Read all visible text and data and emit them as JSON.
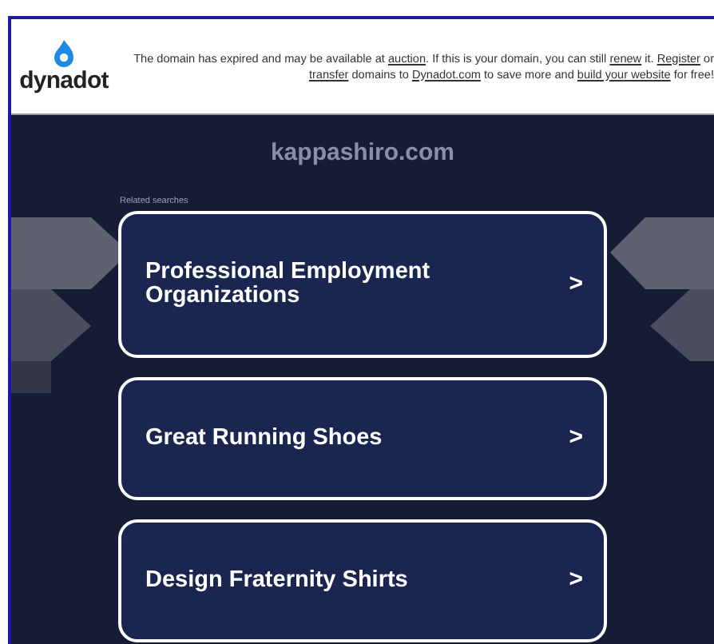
{
  "header": {
    "logo_text": "dynadot",
    "notice": [
      {
        "kind": "text",
        "text": "The domain has expired and may be available at "
      },
      {
        "kind": "link",
        "text": "auction"
      },
      {
        "kind": "text",
        "text": ". If this is your domain, you can still "
      },
      {
        "kind": "link",
        "text": "renew"
      },
      {
        "kind": "text",
        "text": " it. "
      },
      {
        "kind": "link",
        "text": "Register"
      },
      {
        "kind": "text",
        "text": " or "
      },
      {
        "kind": "link",
        "text": "transfer"
      },
      {
        "kind": "text",
        "text": " domains to "
      },
      {
        "kind": "link",
        "text": "Dynadot.com"
      },
      {
        "kind": "text",
        "text": " to save more and "
      },
      {
        "kind": "link",
        "text": "build your website"
      },
      {
        "kind": "text",
        "text": " for free!"
      }
    ]
  },
  "domain": "kappashiro.com",
  "related_label": "Related searches",
  "searches": [
    {
      "label": "Professional Employment Organizations",
      "arrow": ">"
    },
    {
      "label": "Great Running Shoes",
      "arrow": ">"
    },
    {
      "label": "Design Fraternity Shirts",
      "arrow": ">"
    }
  ]
}
